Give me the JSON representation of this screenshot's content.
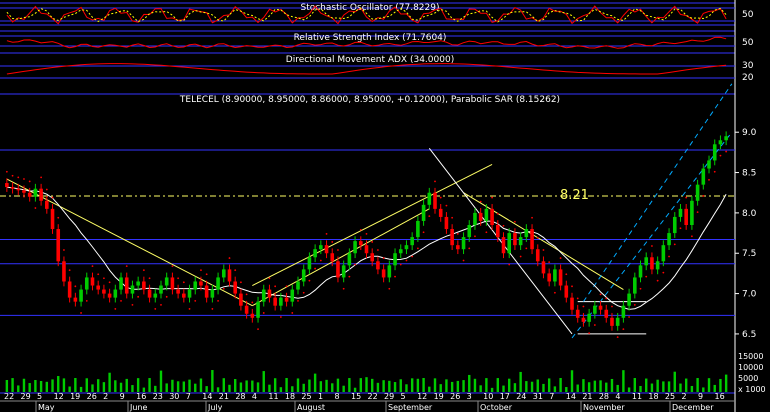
{
  "colors": {
    "background": "#000000",
    "panel_line": "#3333ff",
    "up_candle": "#00cc00",
    "down_candle": "#ff0000",
    "trend_lines": "#ffff66",
    "moving_average": "#ffffff",
    "stochastic_k": "#ff0000",
    "stochastic_d": "#ffff00",
    "rsi": "#ff0000",
    "adx": "#ff0000",
    "sar": "#ff0000",
    "channel": "#00aaff",
    "volume": "#00cc00",
    "text": "#ffffff",
    "reference_label": "#ffff66"
  },
  "panels": {
    "stochastic": {
      "title": "Stochastic Oscillator (77.8229)",
      "ticks": [
        "50"
      ]
    },
    "rsi": {
      "title": "Relative Strength Index (71.7604)",
      "ticks": [
        "50"
      ]
    },
    "adx": {
      "title": "Directional Movement ADX (34.0000)",
      "ticks": [
        "30",
        "20"
      ]
    },
    "price": {
      "title": "TELECEL (8.90000, 8.95000, 8.86000, 8.95000, +0.12000), Parabolic SAR (8.15262)",
      "reference_value_label": "8.21"
    },
    "volume": {
      "tick_labels": [
        "15000",
        "10000",
        "5000",
        "x 1000"
      ]
    }
  },
  "chart_data": {
    "type": "candlestick",
    "title": "TELECEL (8.90000, 8.95000, 8.86000, 8.95000, +0.12000), Parabolic SAR (8.15262)",
    "ylim": [
      6.4,
      9.3
    ],
    "y_ticks": [
      "9.0",
      "8.5",
      "8.0",
      "7.5",
      "7.0",
      "6.5"
    ],
    "horizontal_lines": [
      8.78,
      7.67,
      7.37,
      6.73
    ],
    "reference_level": 8.21,
    "x_tick_labels": [
      "22",
      "29",
      "5",
      "12",
      "19",
      "26",
      "2",
      "9",
      "16",
      "23",
      "30",
      "7",
      "14",
      "21",
      "28",
      "4",
      "11",
      "18",
      "25",
      "1",
      "8",
      "15",
      "22",
      "29",
      "5",
      "12",
      "19",
      "26",
      "3",
      "10",
      "17",
      "24",
      "31",
      "7",
      "14",
      "21",
      "28",
      "4",
      "11",
      "18",
      "25",
      "2",
      "9",
      "16"
    ],
    "month_labels": [
      "May",
      "June",
      "July",
      "August",
      "September",
      "October",
      "November",
      "December"
    ],
    "close": [
      8.32,
      8.3,
      8.28,
      8.25,
      8.2,
      8.3,
      8.15,
      8.05,
      7.8,
      7.4,
      7.15,
      6.95,
      6.9,
      7.05,
      7.2,
      7.1,
      7.05,
      7.0,
      6.95,
      7.05,
      7.2,
      7.0,
      7.1,
      7.15,
      7.05,
      6.95,
      7.0,
      7.1,
      7.2,
      7.05,
      7.0,
      6.95,
      7.05,
      7.15,
      7.1,
      6.95,
      7.05,
      7.2,
      7.3,
      7.15,
      7.0,
      6.85,
      6.75,
      6.7,
      6.9,
      7.05,
      6.95,
      6.85,
      6.95,
      6.9,
      7.05,
      7.15,
      7.3,
      7.45,
      7.55,
      7.6,
      7.5,
      7.4,
      7.2,
      7.35,
      7.5,
      7.65,
      7.6,
      7.5,
      7.4,
      7.3,
      7.2,
      7.35,
      7.5,
      7.55,
      7.6,
      7.7,
      7.9,
      8.1,
      8.25,
      8.05,
      7.95,
      7.8,
      7.6,
      7.55,
      7.7,
      7.85,
      8.0,
      7.9,
      8.05,
      7.85,
      7.7,
      7.5,
      7.75,
      7.6,
      7.7,
      7.8,
      7.55,
      7.4,
      7.25,
      7.15,
      7.3,
      7.1,
      6.95,
      6.8,
      6.7,
      6.65,
      6.75,
      6.85,
      6.8,
      6.7,
      6.6,
      6.7,
      6.85,
      7.0,
      7.2,
      7.35,
      7.45,
      7.3,
      7.4,
      7.6,
      7.75,
      7.95,
      8.05,
      7.85,
      8.15,
      8.35,
      8.55,
      8.65,
      8.85,
      8.9,
      8.95
    ]
  }
}
